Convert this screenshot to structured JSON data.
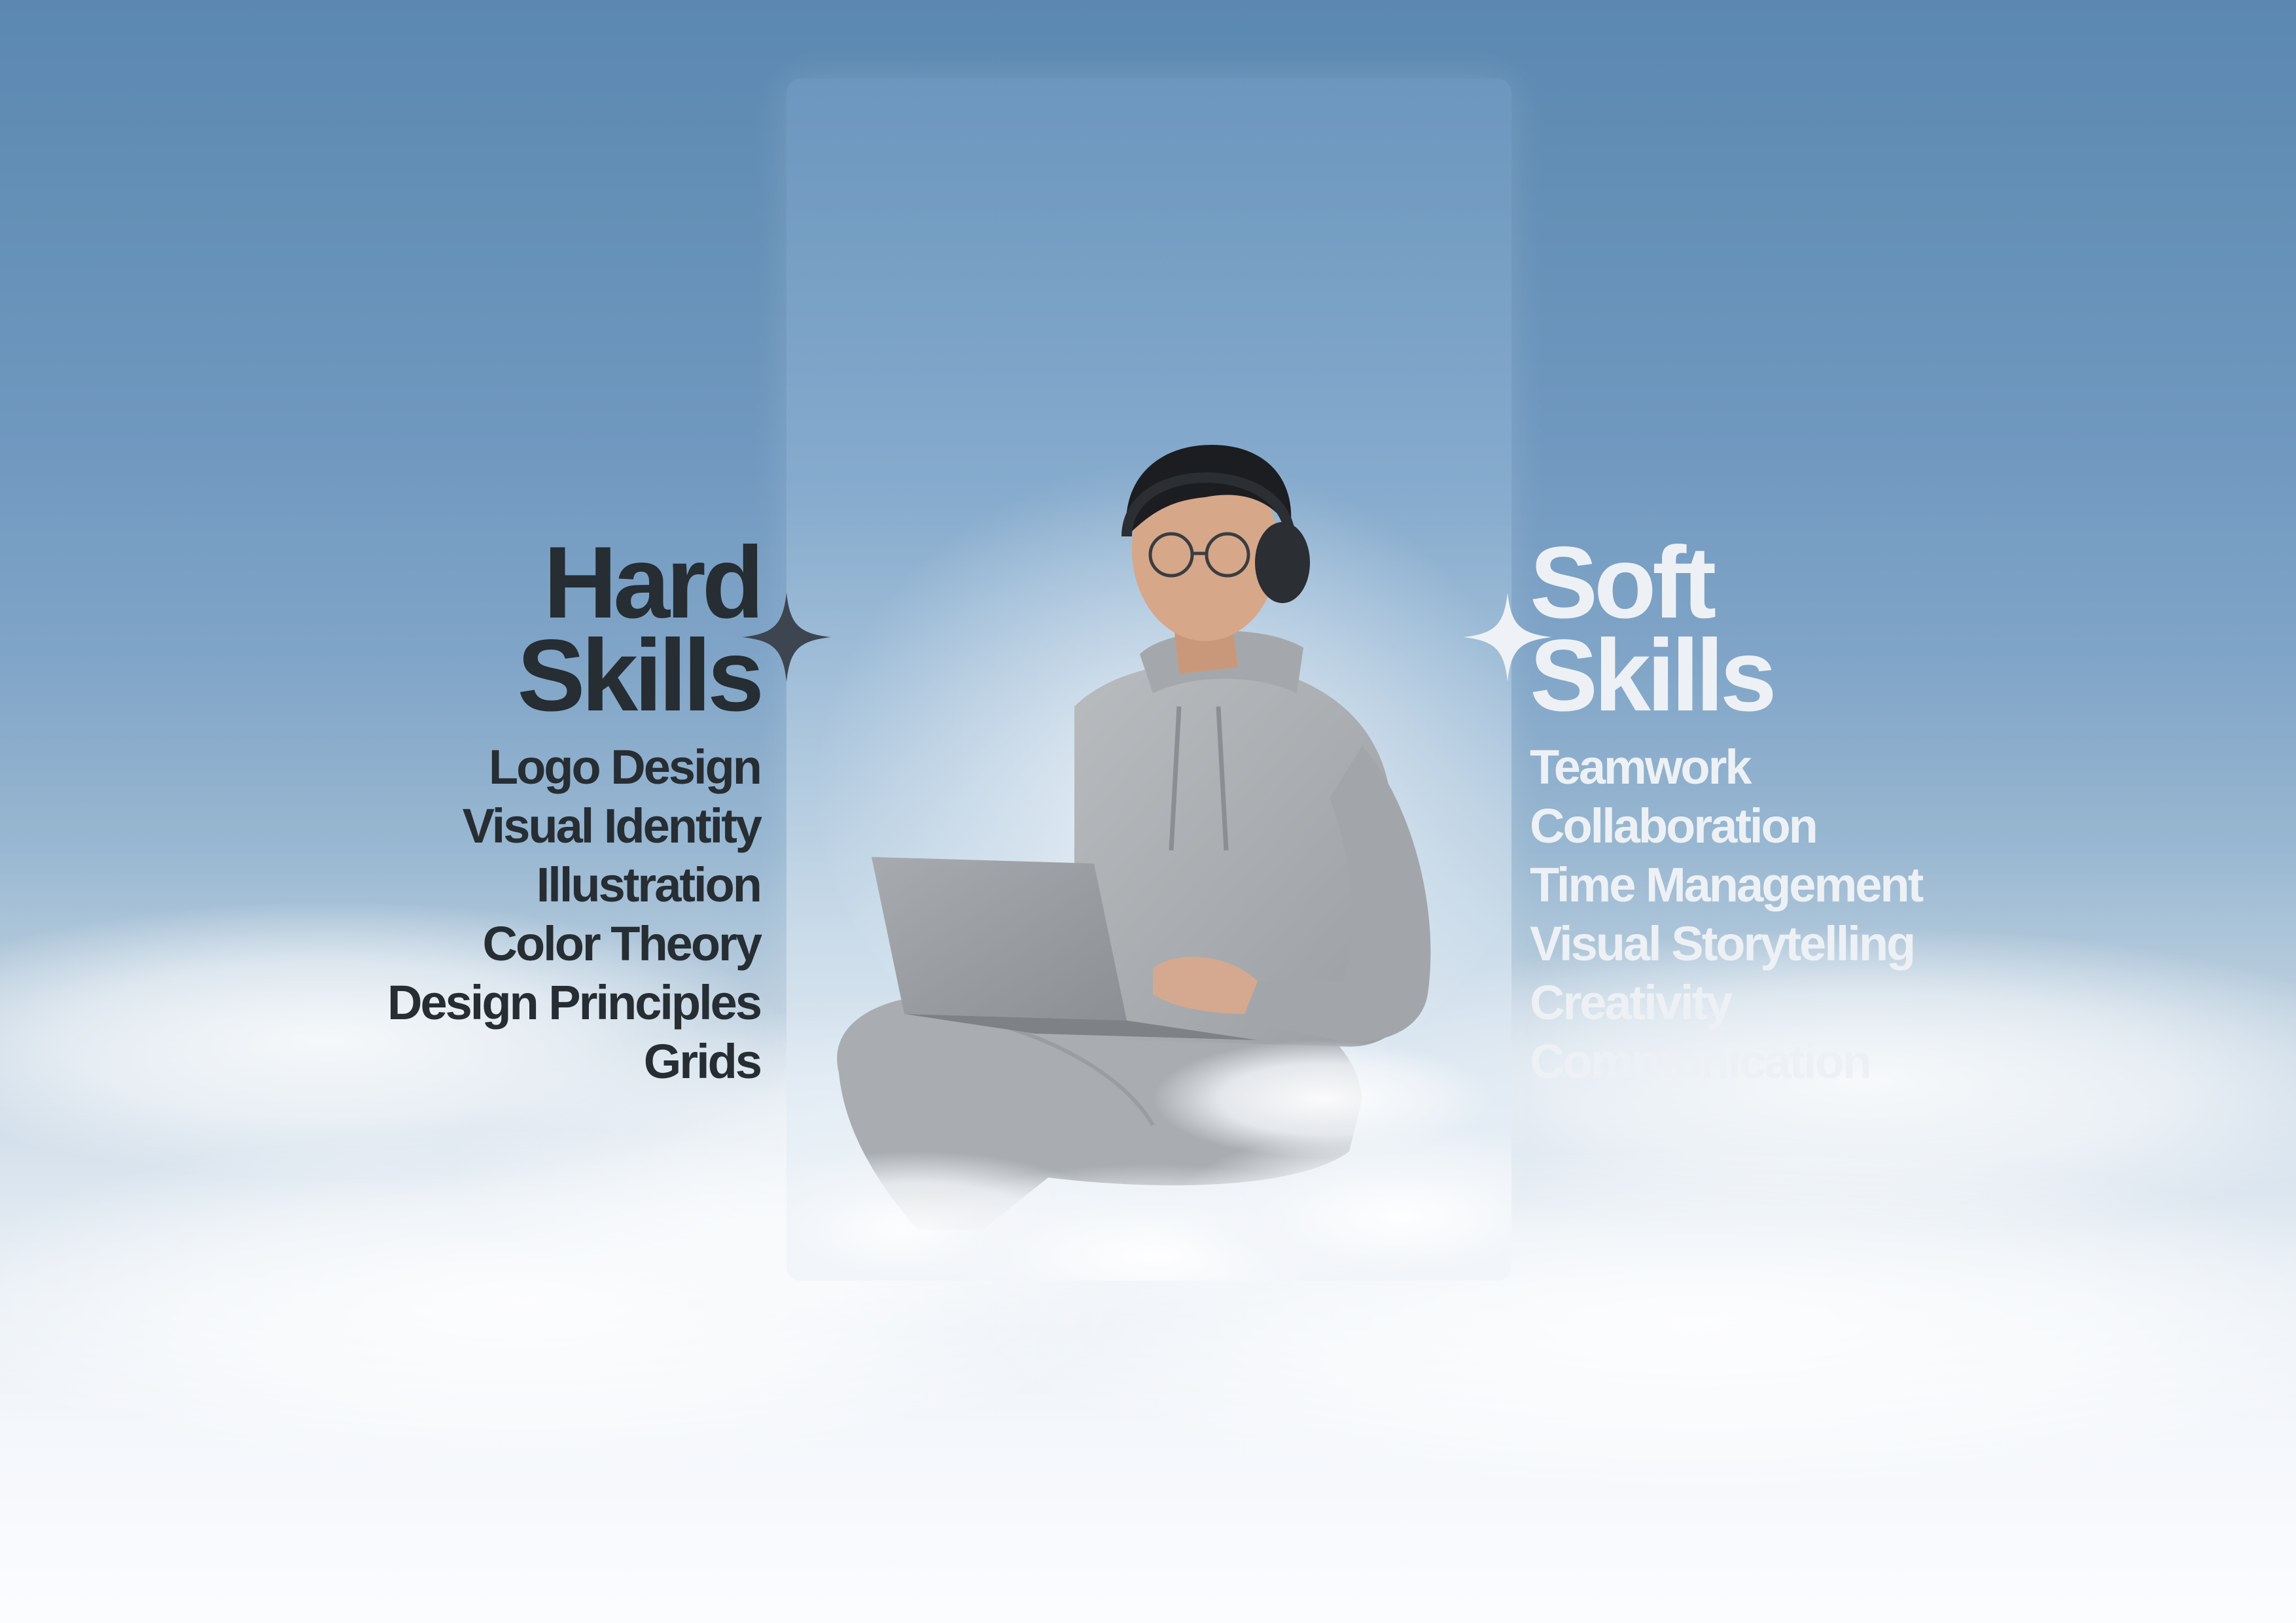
{
  "hard": {
    "title_line1": "Hard",
    "title_line2": "Skills",
    "items": [
      "Logo Design",
      "Visual Identity",
      "Illustration",
      "Color Theory",
      "Design Principles",
      "Grids"
    ]
  },
  "soft": {
    "title_line1": "Soft",
    "title_line2": "Skills",
    "items": [
      "Teamwork",
      "Collaboration",
      "Time Management",
      "Visual Storytelling",
      "Creativity",
      "Communication"
    ]
  },
  "colors": {
    "hard_text": "#262d33",
    "soft_text": "#edf1f5",
    "sky_top": "#5b88b1",
    "cloud": "#f4f7fb"
  },
  "icons": {
    "left": "sparkle-icon",
    "right": "sparkle-icon"
  }
}
